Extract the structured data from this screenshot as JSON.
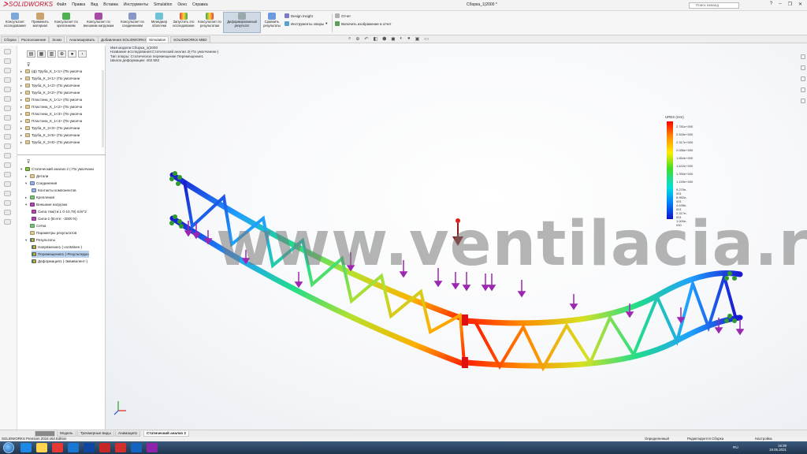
{
  "app": {
    "logo": "SOLIDWORKS",
    "menu": [
      "Файл",
      "Правка",
      "Вид",
      "Вставка",
      "Инструменты",
      "Simulation",
      "Окно",
      "Справка"
    ],
    "document_title": "Сборка_1(2000 *",
    "search_placeholder": "Поиск команд"
  },
  "commands": {
    "consultant_study": "Консультант исследования",
    "apply_material": "Применить материал",
    "consultant_fixtures": "Консультант по креплениям",
    "consultant_loads": "Консультант по внешним нагрузкам",
    "consultant_connections": "Консультант по соединениям",
    "shell_manager": "Менеджер оболочки",
    "run_study": "Запустить это исследование",
    "consultant_results": "Консультант по результатам",
    "deformed_result": "Деформированный результат",
    "compare_results": "Сравнить результаты",
    "design_insight": "Design Insight",
    "plot_tools": "Инструменты эпюры",
    "report": "Отчет",
    "include_image": "Включить изображение в отчет"
  },
  "tabs": [
    "Сборка",
    "Расположение",
    "Эскиз",
    "Анализировать",
    "Добавления SOLIDWORKS",
    "Simulation",
    "SOLIDWORKS MBD"
  ],
  "active_tab": "Simulation",
  "tree_top": [
    "(ф) Труба_К_1<1> (По умолча",
    "Труба_К_2<1> (По умолчани",
    "Труба_К_1<2> (По умолчани",
    "Труба_К_2<2> (По умолчани",
    "Пластина_К_1<1> (По умолча",
    "Пластина_К_1<2> (По умолча",
    "Пластина_К_1<3> (По умолча",
    "Пластина_К_1<4> (По умолча",
    "Труба_К_2<3> (По умолчани",
    "Труба_К_2<5> (По умолчани",
    "Труба_К_2<6> (По умолчани"
  ],
  "tree_sim": {
    "study": "Статический анализ 2 (-По умолчани",
    "parts": "Детали",
    "connections": "Соединения",
    "contacts": "Контакты компонентов",
    "fixtures": "Крепления",
    "external_loads": "Внешние нагрузки",
    "force1": "Сила тяж(ти:1 0-10,79) m/s^2",
    "force2": "Сила-1 (В:ете: -2000 N)",
    "mesh": "Сетка",
    "result_options": "Параметры результатов",
    "results": "Результаты",
    "stress": "Напряжение1 (-vonMises-)",
    "displacement": "Перемещение1 (-Результирую",
    "strain": "Деформация1 (-Эквивалент-)"
  },
  "viewport_info": [
    "Имя модели:Сборка_1(2000",
    "Название исследования:Статический анализ 2(-По умолчанию-)",
    "Тип эпюры: Статическое перемещение Перемещение1",
    "Шкала деформации: 402.582"
  ],
  "legend": {
    "title": "URES (mm)",
    "values": [
      "2.781e+000",
      "2.549e+000",
      "2.317e+000",
      "2.086e+000",
      "1.854e+000",
      "1.622e+000",
      "1.390e+000",
      "1.159e+000",
      "9.270e-001",
      "6.952e-001",
      "4.635e-001",
      "2.317e-001",
      "1.000e-030"
    ],
    "colors": [
      "#ff0000",
      "#1111cc"
    ]
  },
  "watermark": "www.ventilacia.ru",
  "bottom_tabs": [
    "Модель",
    "Трехмерные виды",
    "Анимация1",
    "Статический анализ 2"
  ],
  "active_bottom_tab": "Статический анализ 2",
  "status": {
    "edition": "SOLIDWORKS Premium 2016 x64 Edition",
    "defined": "Определенный",
    "editing": "Редактируется Сборка",
    "custom": "Настройка"
  },
  "taskbar": {
    "lang": "RU",
    "time": "16:39",
    "date": "18.05.2021"
  }
}
